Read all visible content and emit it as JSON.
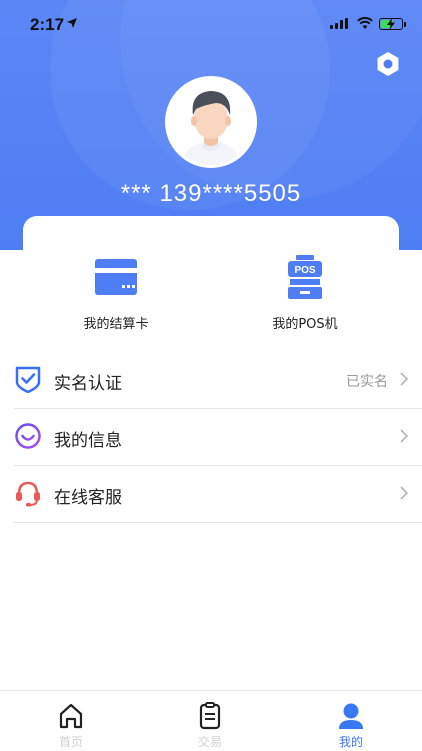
{
  "status_bar": {
    "time": "2:17"
  },
  "profile": {
    "name": "***  139****5505"
  },
  "quick_actions": [
    {
      "label": "我的结算卡",
      "icon": "bank-card-icon"
    },
    {
      "label": "我的POS机",
      "icon": "pos-machine-icon"
    }
  ],
  "menu": [
    {
      "label": "实名认证",
      "value": "已实名",
      "icon": "shield-check-icon",
      "color": "#3a6ff2"
    },
    {
      "label": "我的信息",
      "value": "",
      "icon": "smile-circle-icon",
      "color": "#8a3ff0"
    },
    {
      "label": "在线客服",
      "value": "",
      "icon": "headset-icon",
      "color": "#e85a5a"
    }
  ],
  "tabs": [
    {
      "label": "首页",
      "icon": "home-icon",
      "active": false
    },
    {
      "label": "交易",
      "icon": "clipboard-icon",
      "active": false
    },
    {
      "label": "我的",
      "icon": "person-icon",
      "active": true
    }
  ],
  "colors": {
    "brand": "#4f7df3",
    "tab_inactive": "#d0d0d0",
    "tab_active": "#3a78f2"
  }
}
